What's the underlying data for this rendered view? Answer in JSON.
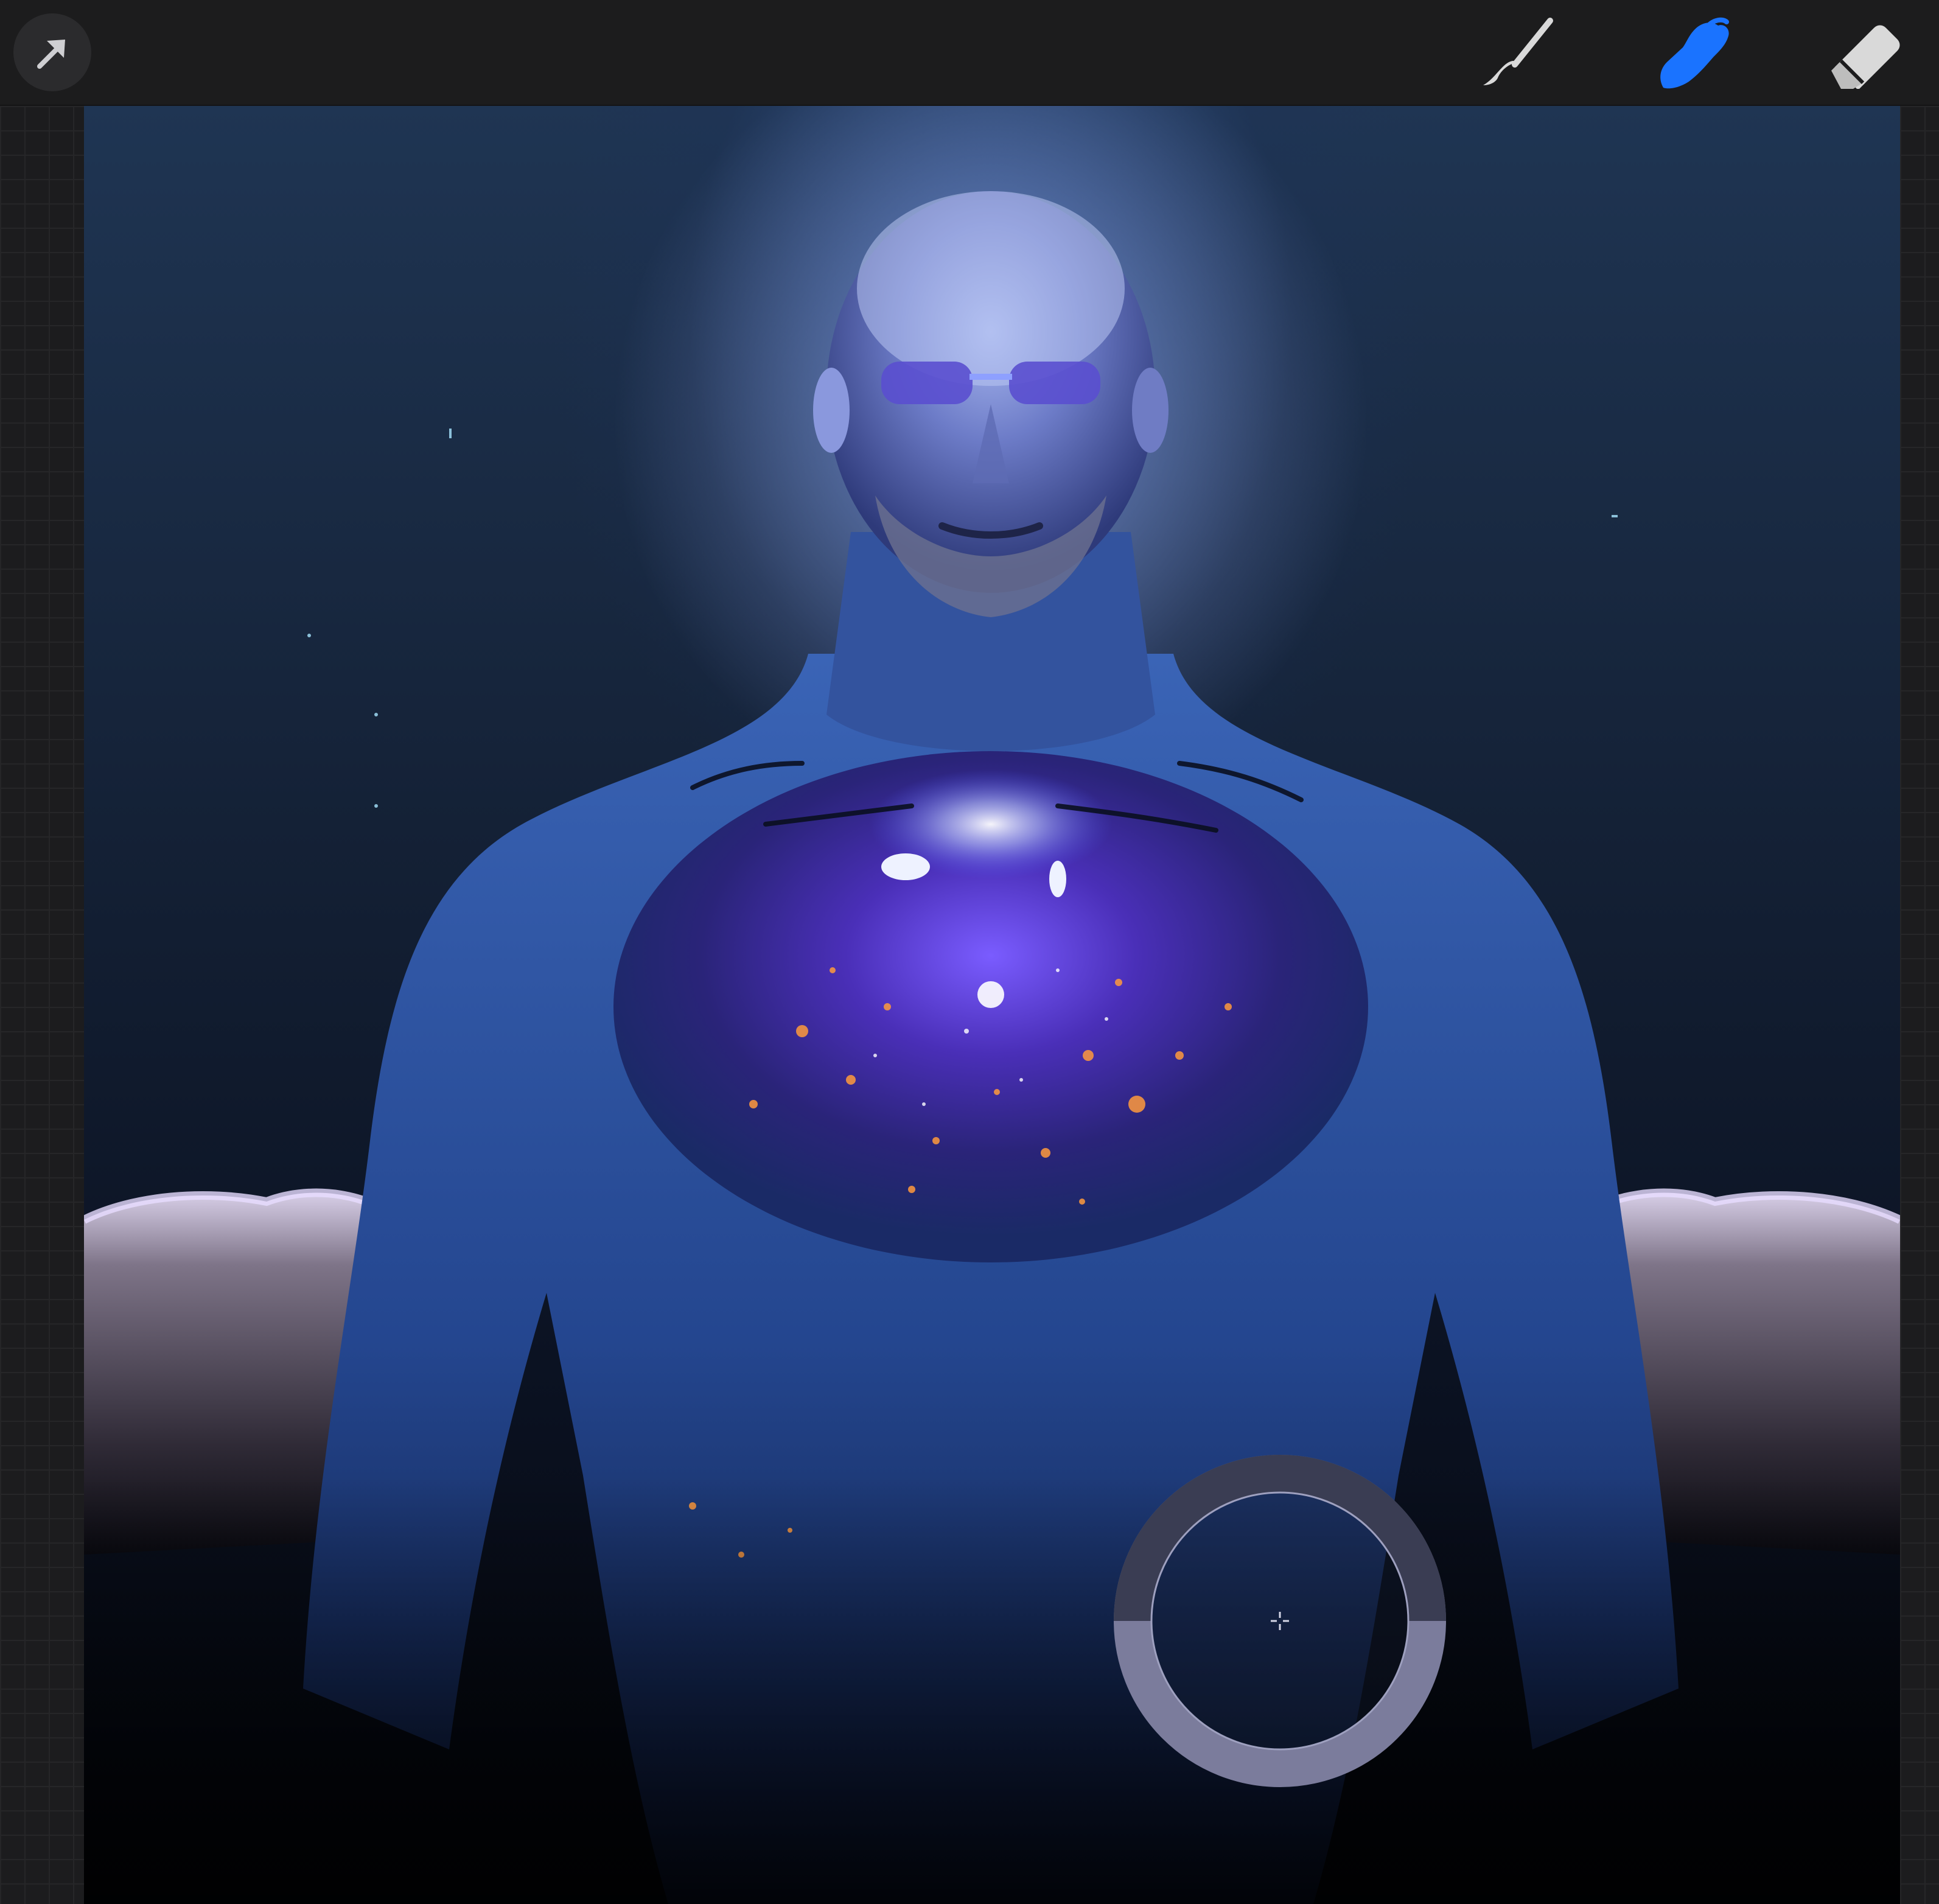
{
  "toolbar": {
    "tools": [
      {
        "name": "actions",
        "icon": "arrow-cursor-icon",
        "active": false
      },
      {
        "name": "brush",
        "icon": "paintbrush-icon",
        "active": false
      },
      {
        "name": "smudge",
        "icon": "smudge-finger-icon",
        "active": true
      },
      {
        "name": "eraser",
        "icon": "eraser-icon",
        "active": false
      }
    ]
  },
  "colors": {
    "toolbar_bg": "#1c1c1d",
    "active_tool": "#1a73ff",
    "inactive_tool": "#d9d9d9",
    "ring": "#7b7c9c"
  },
  "canvas": {
    "artwork": "glowing-blue-cosmic-titan-portrait"
  },
  "brush_size_indicator": {
    "icon": "crosshair-icon"
  }
}
